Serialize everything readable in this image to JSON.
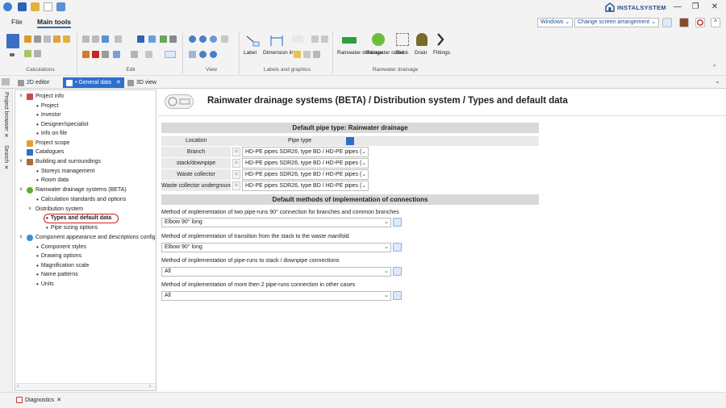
{
  "titlebar": {
    "logo_text": "INSTALSYSTEM",
    "minimize": "—",
    "restore": "❐",
    "close": "✕"
  },
  "menu": {
    "file": "File",
    "main_tools": "Main tools",
    "windows_dropdown": "Windows",
    "screen_dropdown": "Change screen arrangement"
  },
  "ribbon": {
    "groups": [
      "Calculations",
      "Edit",
      "View",
      "Labels and graphics",
      "Rainwater drainage"
    ],
    "label_btn": "Label",
    "dimension_btn": "Dimension line",
    "rainwater_drainage_btn": "Rainwater drainage",
    "rainwater_outlet_btn": "Rainwater outlet",
    "stack_btn": "Stack",
    "drain_btn": "Drain",
    "fittings_btn": "Fittings"
  },
  "tabs": {
    "editor_2d": "2D editor",
    "general_data": "• General data",
    "view_3d": "3D view"
  },
  "side": {
    "project_browser": "Project browser",
    "search": "Search"
  },
  "tree": {
    "project_info": "Project info",
    "project": "Project",
    "investor": "Investor",
    "designer": "Designer/specialist",
    "info_on_file": "Info on file",
    "project_scope": "Project scope",
    "catalogues": "Catalogues",
    "building": "Building and surroundings",
    "storeys": "Storeys management",
    "room_data": "Room data",
    "rainwater": "Rainwater drainage systems (BETA)",
    "calc_standards": "Calculation standards and options",
    "distribution": "Distribution system",
    "types_default": "Types and default data",
    "pipe_sizing": "Pipe sizing options",
    "component_appearance": "Component appearance and descriptions config",
    "component_styles": "Component styles",
    "drawing_options": "Drawing options",
    "magnification": "Magnification scale",
    "name_patterns": "Name patterns",
    "units": "Units"
  },
  "main": {
    "title": "Rainwater drainage systems (BETA) / Distribution system / Types and default data",
    "default_pipe_header": "Default pipe type: Rainwater drainage",
    "col_location": "Location",
    "col_pipe_type": "Pipe type",
    "pipe_rows": [
      {
        "location": "Branch",
        "value": "HD-PE pipes SDR26, type BD / HD-PE pipes ("
      },
      {
        "location": "stack/downpipe",
        "value": "HD-PE pipes SDR26, type BD / HD-PE pipes ("
      },
      {
        "location": "Waste collector",
        "value": "HD-PE pipes SDR26, type BD / HD-PE pipes ("
      },
      {
        "location": "Waste collector underground",
        "value": "HD-PE pipes SDR26, type BD / HD-PE pipes ("
      }
    ],
    "methods_header": "Default methods of implementation of connections",
    "methods": [
      {
        "label": "Method of implementation of two pipe-runs 90° connection for branches and common branches",
        "value": "Elbow 90° long"
      },
      {
        "label": "Method of implementation of transition from the stack to the waste manifold",
        "value": "Elbow 90° long"
      },
      {
        "label": "Method of implementation of pipe-runs to stack / downpipe connections",
        "value": "All"
      },
      {
        "label": "Method of implementation of more then 2 pipe-runs connection in other cases",
        "value": "All"
      }
    ]
  },
  "bottom": {
    "diagnostics": "Diagnostics"
  }
}
